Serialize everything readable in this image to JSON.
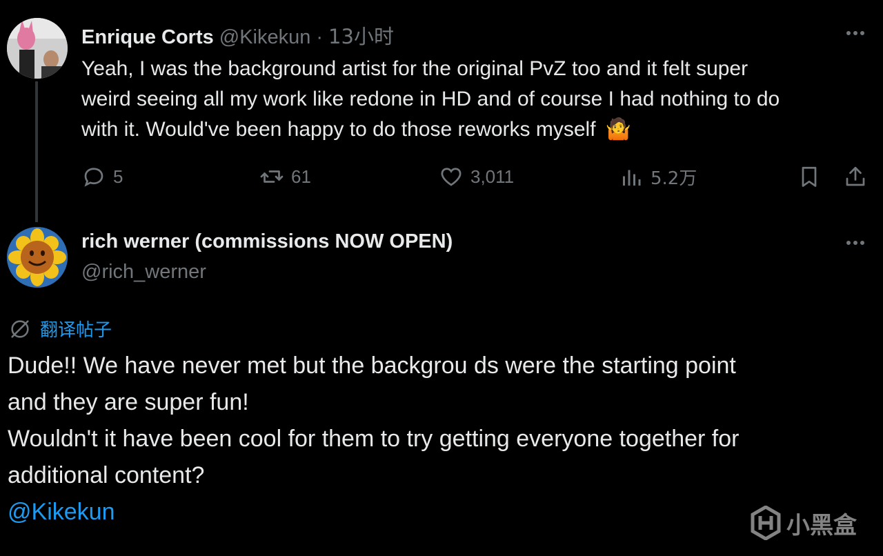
{
  "tweet1": {
    "display_name": "Enrique Corts",
    "handle": "@Kikekun",
    "separator": "·",
    "time": "13小时",
    "text_lines": [
      "Yeah, I was the background artist for the original PvZ too and it felt super",
      "weird seeing all my work like redone in HD and of course I had nothing to do",
      "with it. Would've been happy to do those reworks myself"
    ],
    "emoji": "🤷",
    "actions": {
      "replies": "5",
      "reposts": "61",
      "likes": "3,011",
      "views": "5.2万"
    }
  },
  "tweet2": {
    "display_name": "rich werner (commissions NOW OPEN)",
    "handle": "@rich_werner",
    "translate_label": "翻译帖子",
    "text_lines": [
      "Dude!! We have never met but the backgrou ds were the starting point",
      "and they are super fun!",
      "Wouldn't it have been cool for them to try getting everyone together for",
      "additional content?"
    ],
    "mention": "@Kikekun"
  },
  "watermark": {
    "text": "小黑盒"
  },
  "colors": {
    "background": "#000000",
    "text": "#e7e9ea",
    "muted": "#71767b",
    "link": "#1d9bf0",
    "thread_line": "#333639"
  }
}
